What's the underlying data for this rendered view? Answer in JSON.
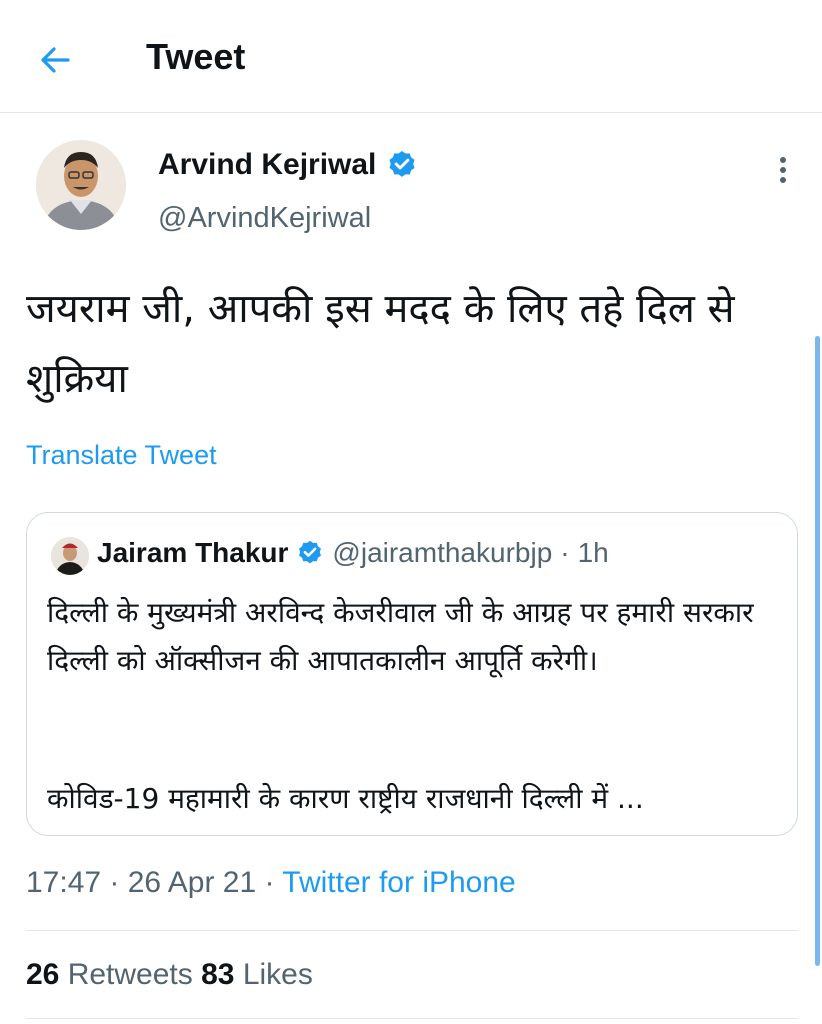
{
  "header": {
    "title": "Tweet",
    "back_icon": "arrow-left-icon"
  },
  "tweet": {
    "author_name": "Arvind Kejriwal",
    "author_handle": "@ArvindKejriwal",
    "verified_icon": "verified-badge-icon",
    "text": "जयराम जी, आपकी इस मदद के लिए तहे दिल से शुक्रिया",
    "translate_label": "Translate Tweet",
    "timestamp": "17:47 · 26 Apr 21 · ",
    "source": "Twitter for iPhone",
    "retweets_count": "26",
    "retweets_label": " Retweets ",
    "likes_count": "83",
    "likes_label": " Likes"
  },
  "quoted": {
    "author_name": "Jairam Thakur",
    "author_handle": "@jairamthakurbjp",
    "dot": "·",
    "time": "1h",
    "text": "दिल्ली के मुख्यमंत्री अरविन्द केजरीवाल जी के आग्रह पर हमारी सरकार दिल्ली को ऑक्सीजन की आपातकालीन आपूर्ति करेगी।",
    "text_more": "कोविड-19 महामारी के कारण राष्ट्रीय राजधानी दिल्ली में ..."
  },
  "colors": {
    "accent": "#1d9bf0",
    "text": "#0f1419",
    "secondary": "#536471",
    "border": "#cfd9de"
  }
}
